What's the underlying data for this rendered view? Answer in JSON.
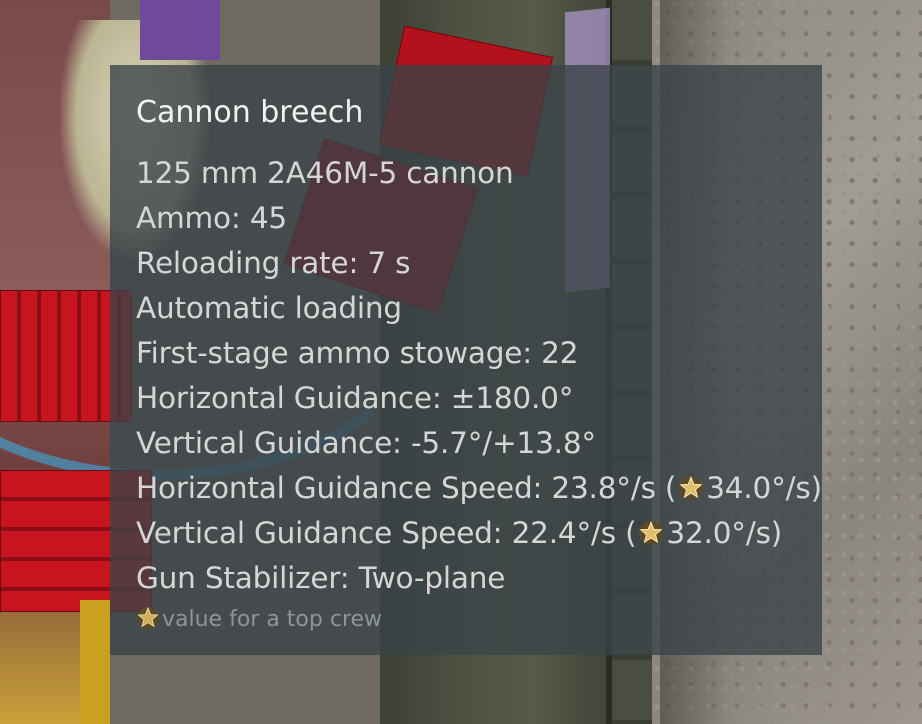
{
  "tooltip": {
    "title": "Cannon breech",
    "lines": [
      "125 mm 2A46M-5 cannon",
      "Ammo: 45",
      "Reloading rate: 7 s",
      "Automatic loading",
      "First-stage ammo stowage: 22",
      "Horizontal Guidance: ±180.0°",
      "Vertical Guidance: -5.7°/+13.8°"
    ],
    "speed_lines": [
      {
        "label": "Horizontal Guidance Speed: 23.8°/s (",
        "top_value": "34.0°/s)"
      },
      {
        "label": "Vertical Guidance Speed: 22.4°/s (",
        "top_value": "32.0°/s)"
      }
    ],
    "stabilizer": "Gun Stabilizer: Two-plane",
    "footnote": "value for a top crew",
    "star_icon": "top-crew-star-icon",
    "colors": {
      "background": "#3a4248",
      "title": "#f2f2f2",
      "text": "#d6d6d6",
      "footnote": "#8d949a",
      "star": "#d9b25a"
    }
  }
}
